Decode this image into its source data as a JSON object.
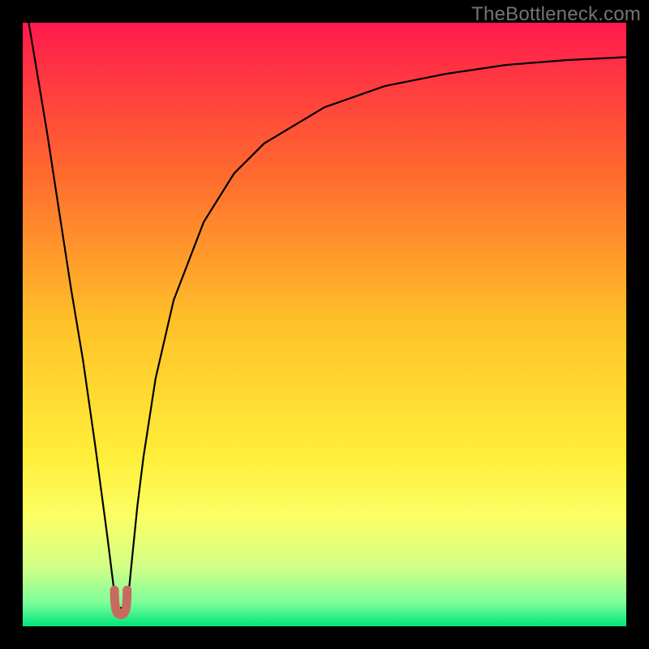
{
  "attribution": "TheBottleneck.com",
  "chart_data": {
    "type": "line",
    "title": "",
    "xlabel": "",
    "ylabel": "",
    "xlim": [
      0,
      100
    ],
    "ylim": [
      0,
      100
    ],
    "grid": false,
    "legend": false,
    "background_gradient_stops": [
      {
        "pos": 0.0,
        "color": "#ff1a4d"
      },
      {
        "pos": 0.25,
        "color": "#ff6a2e"
      },
      {
        "pos": 0.5,
        "color": "#ffc229"
      },
      {
        "pos": 0.72,
        "color": "#ffee3a"
      },
      {
        "pos": 0.82,
        "color": "#fbff66"
      },
      {
        "pos": 0.9,
        "color": "#d3ff87"
      },
      {
        "pos": 0.96,
        "color": "#7fff9a"
      },
      {
        "pos": 1.0,
        "color": "#00e57a"
      }
    ],
    "series": [
      {
        "name": "bottleneck-curve",
        "color": "#000000",
        "x": [
          0.0,
          2.0,
          4.0,
          6.0,
          8.0,
          10.0,
          12.0,
          14.0,
          15.0,
          15.5,
          16.0,
          17.0,
          17.5,
          18.0,
          19.0,
          20.0,
          22.0,
          25.0,
          30.0,
          35.0,
          40.0,
          50.0,
          60.0,
          70.0,
          80.0,
          90.0,
          100.0
        ],
        "y": [
          106.0,
          94.0,
          82.0,
          69.0,
          56.0,
          44.0,
          30.0,
          15.0,
          7.0,
          4.0,
          3.0,
          3.2,
          5.0,
          10.0,
          20.0,
          28.0,
          41.0,
          54.0,
          67.0,
          75.0,
          80.0,
          86.0,
          89.5,
          91.5,
          93.0,
          93.8,
          94.3
        ]
      },
      {
        "name": "marker-optimum",
        "color": "#c96a5f",
        "type": "marker-ushape",
        "x_range": [
          15.2,
          17.3
        ],
        "y_range": [
          3.0,
          6.0
        ]
      }
    ]
  }
}
